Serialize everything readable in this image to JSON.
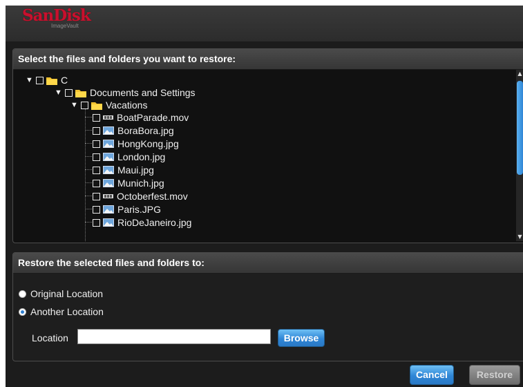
{
  "header": {
    "brand": "SanDisk",
    "product": "ImageVault"
  },
  "tree_panel": {
    "title": "Select the files and folders you want to restore:",
    "items": [
      {
        "label": "C",
        "type": "folder"
      },
      {
        "label": "Documents and Settings",
        "type": "folder"
      },
      {
        "label": "Vacations",
        "type": "folder"
      },
      {
        "label": "BoatParade.mov",
        "type": "video"
      },
      {
        "label": "BoraBora.jpg",
        "type": "image"
      },
      {
        "label": "HongKong.jpg",
        "type": "image"
      },
      {
        "label": "London.jpg",
        "type": "image"
      },
      {
        "label": "Maui.jpg",
        "type": "image"
      },
      {
        "label": "Munich.jpg",
        "type": "image"
      },
      {
        "label": "Octoberfest.mov",
        "type": "video"
      },
      {
        "label": "Paris.JPG",
        "type": "image"
      },
      {
        "label": "RioDeJaneiro.jpg",
        "type": "image"
      }
    ]
  },
  "dest_panel": {
    "title": "Restore the selected files and folders to:",
    "options": [
      {
        "label": "Original Location",
        "selected": false
      },
      {
        "label": "Another Location",
        "selected": true
      }
    ],
    "location_label": "Location",
    "location_value": "",
    "browse_label": "Browse"
  },
  "footer": {
    "cancel_label": "Cancel",
    "restore_label": "Restore"
  },
  "colors": {
    "brand_red": "#c8102e",
    "accent_blue": "#2f86d6",
    "background": "#1c1c1c"
  }
}
